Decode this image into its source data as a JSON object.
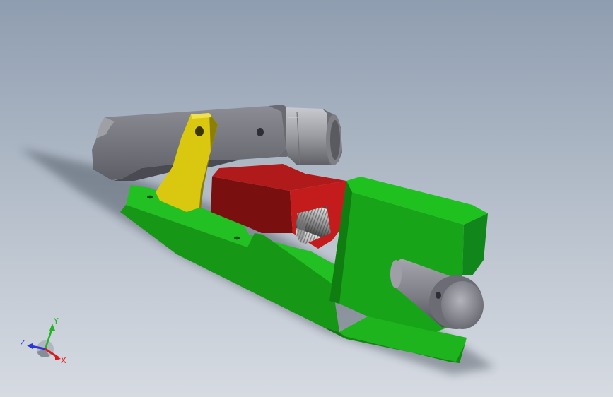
{
  "view": {
    "background_top": "#8f9db0",
    "background_bottom": "#d6dbe2"
  },
  "model": {
    "parts": [
      {
        "name": "base-plate",
        "color": "#1fb21f"
      },
      {
        "name": "fixed-jaw-block",
        "color": "#1fb21f"
      },
      {
        "name": "moving-jaw",
        "color": "#b41414"
      },
      {
        "name": "lead-screw",
        "color": "#b8b8b8"
      },
      {
        "name": "clamp-lever",
        "color": "#7d7e85"
      },
      {
        "name": "link-plate",
        "color": "#d4c20c"
      },
      {
        "name": "sleeve-nut",
        "color": "#9a9ba0"
      },
      {
        "name": "handle-pin",
        "color": "#8a8b92"
      }
    ]
  },
  "triad": {
    "x_label": "X",
    "y_label": "Y",
    "z_label": "Z",
    "x_color": "#d81c1c",
    "y_color": "#22b422",
    "z_color": "#2b35d6"
  }
}
